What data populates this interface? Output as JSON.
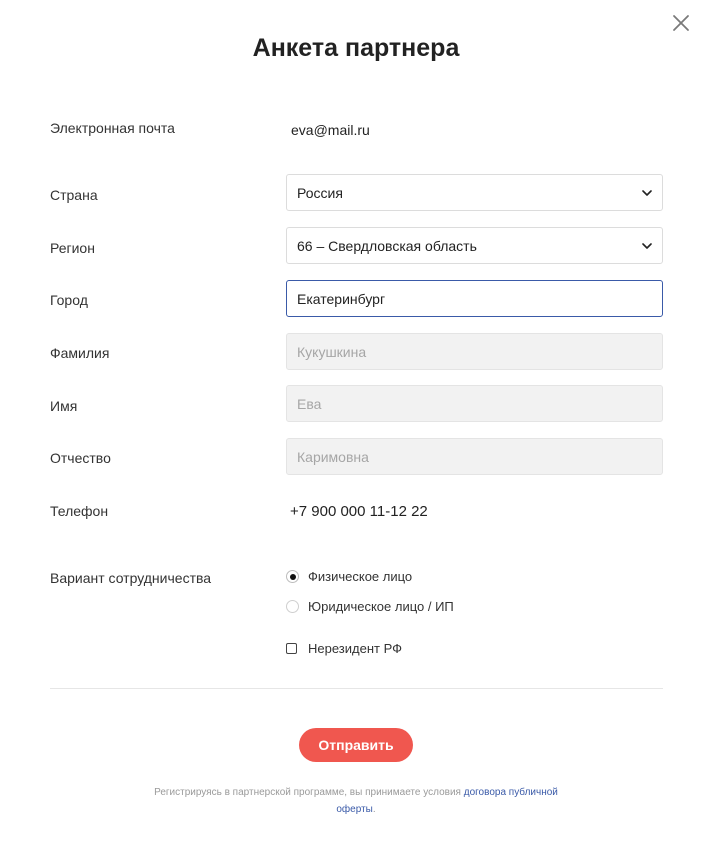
{
  "modal": {
    "title": "Анкета партнера"
  },
  "fields": {
    "email": {
      "label": "Электронная почта",
      "value": "eva@mail.ru"
    },
    "country": {
      "label": "Страна",
      "value": "Россия"
    },
    "region": {
      "label": "Регион",
      "value": "66 – Свердловская область"
    },
    "city": {
      "label": "Город",
      "value": "Екатеринбург"
    },
    "last_name": {
      "label": "Фамилия",
      "placeholder": "Кукушкина"
    },
    "first_name": {
      "label": "Имя",
      "placeholder": "Ева"
    },
    "middle_name": {
      "label": "Отчество",
      "placeholder": "Каримовна"
    },
    "phone": {
      "label": "Телефон",
      "value": "+7 900 000 11-12 22"
    }
  },
  "cooperation": {
    "label": "Вариант сотрудничества",
    "options": [
      {
        "label": "Физическое лицо",
        "selected": true
      },
      {
        "label": "Юридическое лицо / ИП",
        "selected": false
      }
    ],
    "nonresident_label": "Нерезидент РФ",
    "nonresident_checked": false
  },
  "submit_label": "Отправить",
  "footer": {
    "text": "Регистрируясь в партнерской программе, вы принимаете условия ",
    "link": "договора публичной оферты",
    "end": "."
  },
  "icons": {
    "close": "close-icon",
    "chevron": "chevron-down-icon"
  },
  "colors": {
    "accent": "#f0574f",
    "focus_border": "#3a5aa8",
    "link": "#3a5aa8",
    "disabled_bg": "#f2f2f2"
  }
}
